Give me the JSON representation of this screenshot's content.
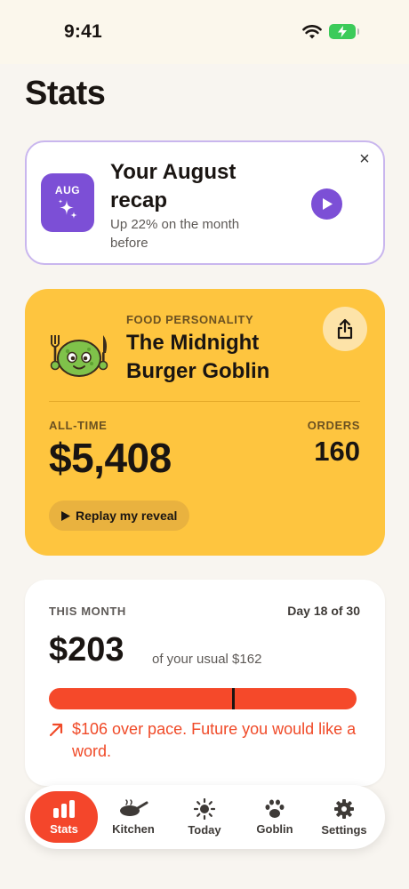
{
  "status_bar": {
    "time": "9:41"
  },
  "page": {
    "title": "Stats"
  },
  "recap": {
    "badge_month": "AUG",
    "title": "Your August recap",
    "subtitle": "Up 22% on the month before",
    "close_glyph": "×",
    "icons": {
      "sparkle": "sparkle-icon",
      "play": "play-icon",
      "close": "close-icon"
    }
  },
  "personality": {
    "label": "FOOD PERSONALITY",
    "name": "The Midnight Burger Goblin",
    "alltime_label": "ALL-TIME",
    "alltime_value": "$5,408",
    "orders_label": "ORDERS",
    "orders_value": "160",
    "replay_label": "Replay my reveal",
    "colors": {
      "card": "#fec53f"
    }
  },
  "this_month": {
    "label": "THIS MONTH",
    "day": "Day 18 of 30",
    "spent": "$203",
    "usual": "of your usual $162",
    "pace_marker_fraction": 0.6,
    "warning": "$106 over pace. Future you would like a word.",
    "colors": {
      "bar": "#f5492a",
      "warning": "#f04a28"
    }
  },
  "tabs": [
    {
      "label": "Stats",
      "icon": "bar-chart-icon",
      "active": true
    },
    {
      "label": "Kitchen",
      "icon": "pan-icon",
      "active": false
    },
    {
      "label": "Today",
      "icon": "sun-icon",
      "active": false
    },
    {
      "label": "Goblin",
      "icon": "paw-icon",
      "active": false
    },
    {
      "label": "Settings",
      "icon": "gear-icon",
      "active": false
    }
  ]
}
